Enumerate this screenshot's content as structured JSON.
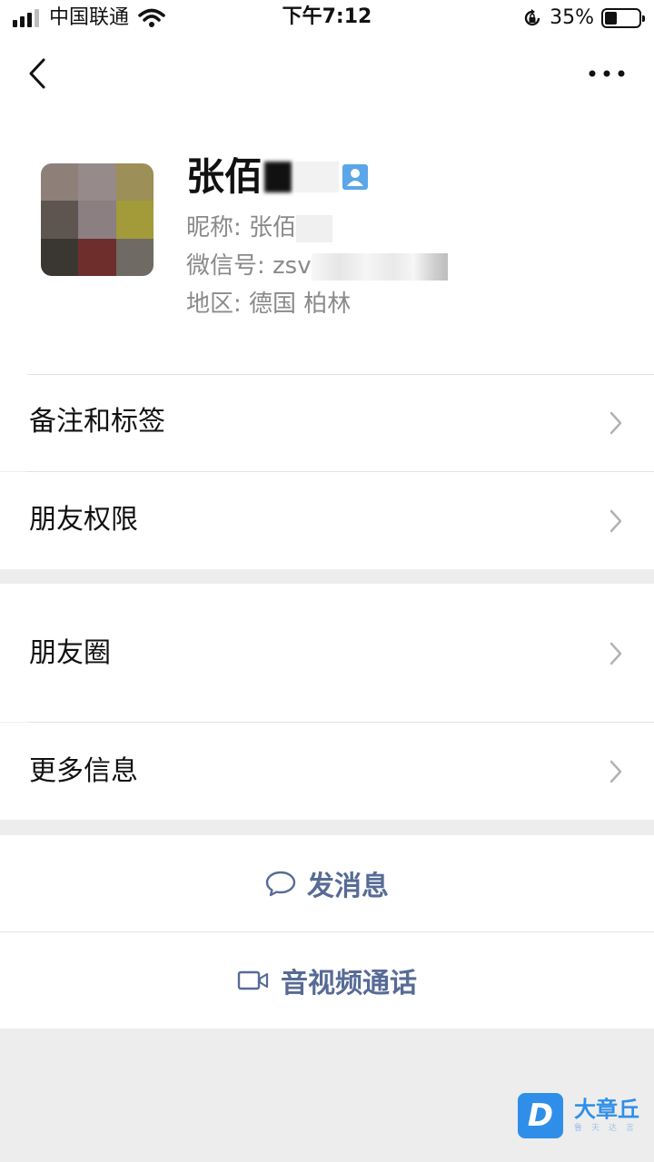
{
  "status_bar": {
    "carrier": "中国联通",
    "time": "下午7:12",
    "battery_percent": "35%",
    "battery_level": 0.35,
    "signal_bars": 3,
    "icons": [
      "signal-icon",
      "wifi-icon",
      "orientation-lock-icon",
      "battery-icon"
    ]
  },
  "nav": {
    "back_icon": "chevron-left-icon",
    "more_icon": "more-dots-icon"
  },
  "profile": {
    "name": "张佰",
    "nickname_label": "昵称: 张佰",
    "wechat_id_label": "微信号: zsv",
    "region_label": "地区: 德国 柏林",
    "badge_icon": "contact-person-icon",
    "avatar_colors": [
      "#8f7f79",
      "#968a8b",
      "#9c8f57",
      "#5e5550",
      "#8b7f82",
      "#a39a3a",
      "#3a3732",
      "#6e2f2c",
      "#6f6a63"
    ]
  },
  "menu": {
    "remark_tags": "备注和标签",
    "friend_permissions": "朋友权限",
    "moments": "朋友圈",
    "more_info": "更多信息"
  },
  "actions": {
    "send_message": "发消息",
    "video_call": "音视频通话"
  },
  "watermark": {
    "logo_letter": "D",
    "title": "大章丘",
    "subtitle": "鲁天达言"
  },
  "colors": {
    "link_blue": "#576b95",
    "background": "#ededed",
    "watermark_blue": "#2f8fe8"
  }
}
